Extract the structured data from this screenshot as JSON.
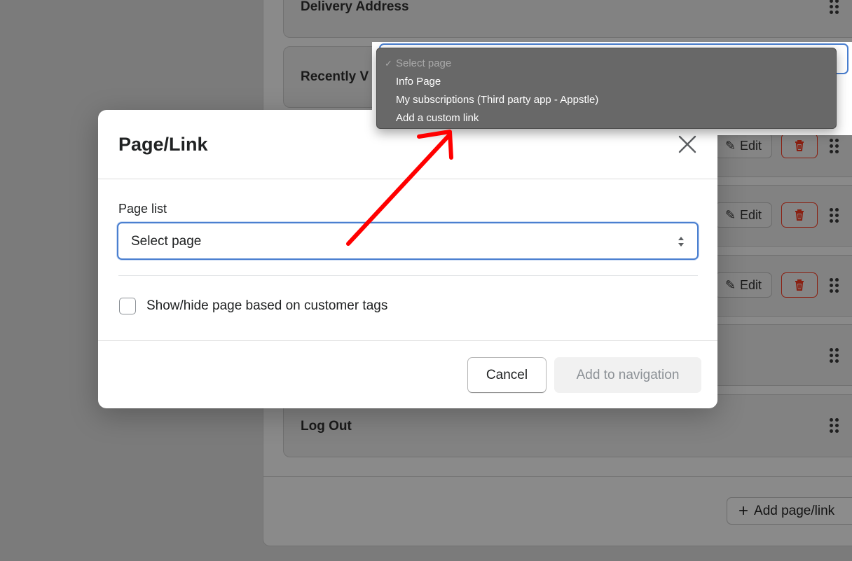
{
  "background": {
    "nav_items": [
      {
        "label": "Delivery Address"
      },
      {
        "label": "Recently V"
      },
      {
        "label": "Log Out"
      }
    ],
    "edit_label": "Edit",
    "add_page_link_label": "Add page/link"
  },
  "dropdown": {
    "options": [
      {
        "label": "Select page",
        "selected": true
      },
      {
        "label": "Info Page",
        "selected": false
      },
      {
        "label": "My subscriptions (Third party app - Appstle)",
        "selected": false
      },
      {
        "label": "Add a custom link",
        "selected": false
      }
    ],
    "check_glyph": "✓"
  },
  "modal": {
    "title": "Page/Link",
    "field_label": "Page list",
    "select_value": "Select page",
    "checkbox_label": "Show/hide page based on customer tags",
    "checkbox_checked": false,
    "cancel_label": "Cancel",
    "submit_label": "Add to navigation",
    "submit_disabled": true
  },
  "colors": {
    "focus_blue": "#4a7fd0",
    "danger_red": "#8a1f11",
    "annotation_red": "#ff0000"
  }
}
